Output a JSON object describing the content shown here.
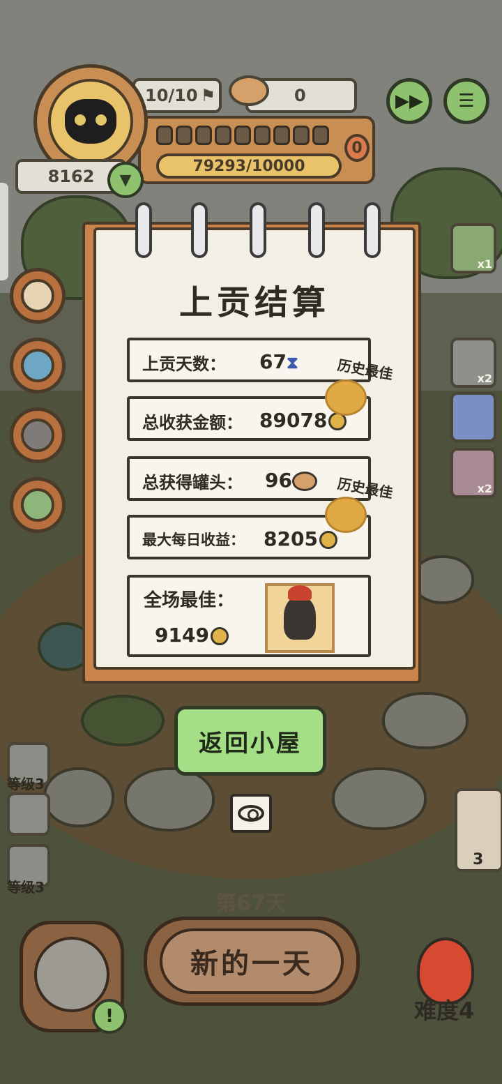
{
  "hud": {
    "capacity": "10/10",
    "cans": "0",
    "score": "8162",
    "progress": "79293/10000",
    "segments": 10,
    "badge": "0",
    "fast_forward_icon": "fast-forward-icon",
    "menu_icon": "menu-icon"
  },
  "summary": {
    "title": "上贡结算",
    "rows": [
      {
        "label": "上贡天数：",
        "value": "67",
        "icon": "hourglass-icon"
      },
      {
        "label": "总收获金额：",
        "value": "89078",
        "icon": "paw-coin-icon",
        "best": "历史最佳"
      },
      {
        "label": "总获得罐头：",
        "value": "96",
        "icon": "can-icon"
      },
      {
        "label": "最大每日收益：",
        "value": "8205",
        "icon": "paw-coin-icon",
        "best": "历史最佳"
      }
    ],
    "mvp_label": "全场最佳：",
    "mvp_value": "9149"
  },
  "buttons": {
    "return_home": "返回小屋",
    "new_day": "新的一天"
  },
  "day_label": "第67天",
  "difficulty": "难度4",
  "side_items": [
    {
      "count": "x1"
    },
    {
      "count": "x2"
    },
    {
      "count": ""
    },
    {
      "count": "x2"
    }
  ],
  "levels": [
    "等级3",
    "等级3"
  ],
  "owl_count": "3"
}
